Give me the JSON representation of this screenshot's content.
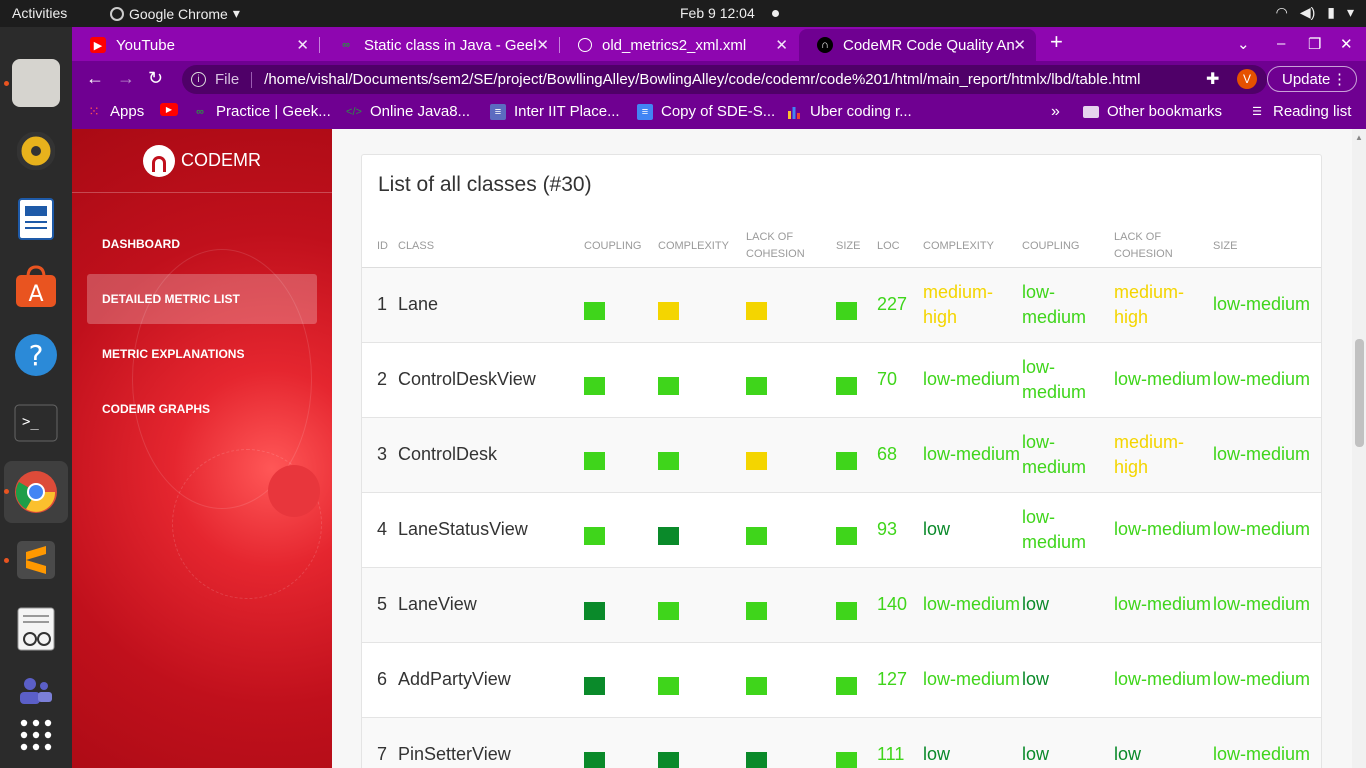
{
  "system": {
    "activities": "Activities",
    "app_name": "Google Chrome",
    "clock": "Feb 9  12:04"
  },
  "tabs": [
    {
      "title": "YouTube",
      "icon": "youtube-icon",
      "color": "#ff0000"
    },
    {
      "title": "Static class in Java - Geek",
      "icon": "geeksforgeeks-icon",
      "color": "#2f8d46"
    },
    {
      "title": "old_metrics2_xml.xml",
      "icon": "globe-icon",
      "color": "#ffffff"
    },
    {
      "title": "CodeMR Code Quality An",
      "icon": "codemr-icon",
      "color": "#000000"
    }
  ],
  "toolbar": {
    "scheme": "File",
    "url": "/home/vishal/Documents/sem2/SE/project/BowllingAlley/BowlingAlley/code/codemr/code%201/html/main_report/htmlx/lbd/table.html",
    "avatar_letter": "V",
    "update_label": "Update"
  },
  "bookmarks": [
    {
      "label": "Apps"
    },
    {
      "label": ""
    },
    {
      "label": "Practice | Geek..."
    },
    {
      "label": "Online Java8..."
    },
    {
      "label": "Inter IIT Place..."
    },
    {
      "label": "Copy of SDE-S..."
    },
    {
      "label": "Uber coding r..."
    }
  ],
  "bookmarks_right": {
    "other": "Other bookmarks",
    "reading": "Reading list"
  },
  "sidebar": {
    "brand": "CODEMR",
    "items": [
      "DASHBOARD",
      "DETAILED METRIC LIST",
      "METRIC EXPLANATIONS",
      "CODEMR GRAPHS"
    ]
  },
  "card": {
    "title": "List of all classes (#30)",
    "headers": [
      "ID",
      "CLASS",
      "COUPLING",
      "COMPLEXITY",
      "LACK OF COHESION",
      "SIZE",
      "LOC",
      "COMPLEXITY",
      "COUPLING",
      "LACK OF COHESION",
      "SIZE"
    ]
  },
  "levels": {
    "low": {
      "color": "#0a8a2a"
    },
    "low-medium": {
      "color": "#3fd51b"
    },
    "medium-high": {
      "color": "#f4d500"
    }
  },
  "rows": [
    {
      "id": "1",
      "class": "Lane",
      "coupling": "low-medium",
      "complexity": "medium-high",
      "cohesion": "medium-high",
      "size": "low-medium",
      "loc": "227",
      "t_complexity": "medium-high",
      "t_coupling": "low-medium",
      "t_cohesion": "medium-high",
      "t_size": "low-medium"
    },
    {
      "id": "2",
      "class": "ControlDeskView",
      "coupling": "low-medium",
      "complexity": "low-medium",
      "cohesion": "low-medium",
      "size": "low-medium",
      "loc": "70",
      "t_complexity": "low-medium",
      "t_coupling": "low-medium",
      "t_cohesion": "low-medium",
      "t_size": "low-medium"
    },
    {
      "id": "3",
      "class": "ControlDesk",
      "coupling": "low-medium",
      "complexity": "low-medium",
      "cohesion": "medium-high",
      "size": "low-medium",
      "loc": "68",
      "t_complexity": "low-medium",
      "t_coupling": "low-medium",
      "t_cohesion": "medium-high",
      "t_size": "low-medium"
    },
    {
      "id": "4",
      "class": "LaneStatusView",
      "coupling": "low-medium",
      "complexity": "low",
      "cohesion": "low-medium",
      "size": "low-medium",
      "loc": "93",
      "t_complexity": "low",
      "t_coupling": "low-medium",
      "t_cohesion": "low-medium",
      "t_size": "low-medium"
    },
    {
      "id": "5",
      "class": "LaneView",
      "coupling": "low",
      "complexity": "low-medium",
      "cohesion": "low-medium",
      "size": "low-medium",
      "loc": "140",
      "t_complexity": "low-medium",
      "t_coupling": "low",
      "t_cohesion": "low-medium",
      "t_size": "low-medium"
    },
    {
      "id": "6",
      "class": "AddPartyView",
      "coupling": "low",
      "complexity": "low-medium",
      "cohesion": "low-medium",
      "size": "low-medium",
      "loc": "127",
      "t_complexity": "low-medium",
      "t_coupling": "low",
      "t_cohesion": "low-medium",
      "t_size": "low-medium"
    },
    {
      "id": "7",
      "class": "PinSetterView",
      "coupling": "low",
      "complexity": "low",
      "cohesion": "low",
      "size": "low-medium",
      "loc": "111",
      "t_complexity": "low",
      "t_coupling": "low",
      "t_cohesion": "low",
      "t_size": "low-medium"
    }
  ]
}
